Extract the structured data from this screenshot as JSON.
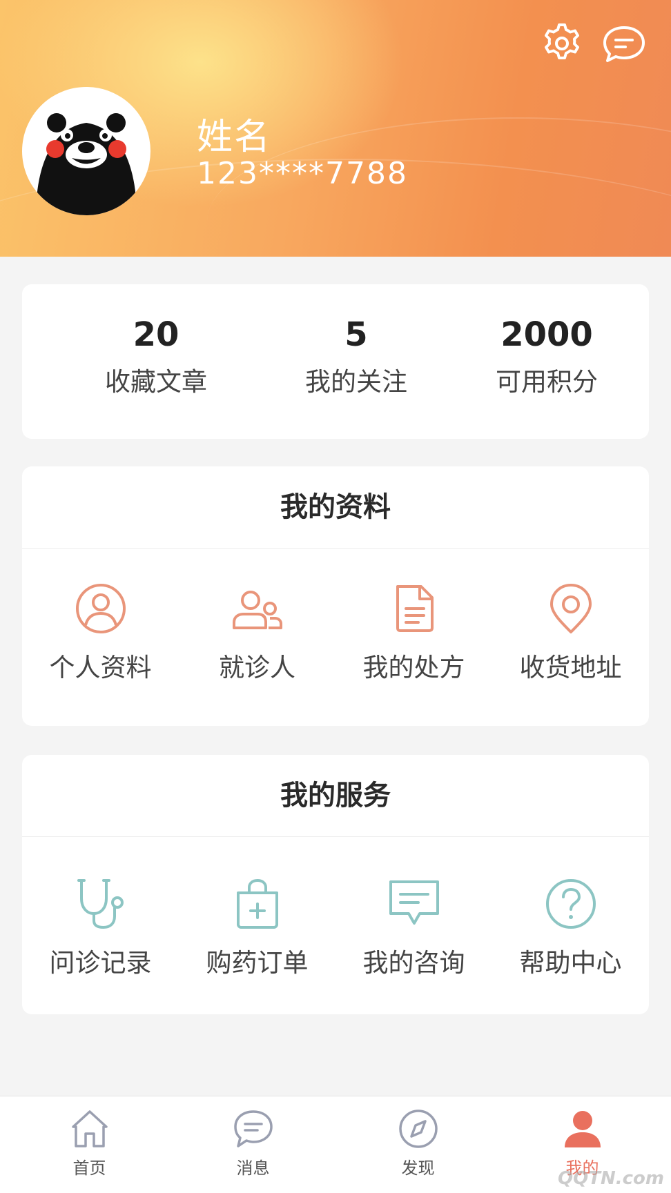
{
  "profile": {
    "name": "姓名",
    "phone": "123****7788"
  },
  "header": {
    "settings_icon": "gear-icon",
    "message_icon": "chat-bubble-icon"
  },
  "stats": [
    {
      "value": "20",
      "label": "收藏文章"
    },
    {
      "value": "5",
      "label": "我的关注"
    },
    {
      "value": "2000",
      "label": "可用积分"
    }
  ],
  "my_info": {
    "title": "我的资料",
    "items": [
      {
        "label": "个人资料",
        "icon": "user-circle-icon"
      },
      {
        "label": "就诊人",
        "icon": "patients-icon"
      },
      {
        "label": "我的处方",
        "icon": "document-icon"
      },
      {
        "label": "收货地址",
        "icon": "location-pin-icon"
      }
    ]
  },
  "my_services": {
    "title": "我的服务",
    "items": [
      {
        "label": "问诊记录",
        "icon": "stethoscope-icon"
      },
      {
        "label": "购药订单",
        "icon": "shopping-bag-icon"
      },
      {
        "label": "我的咨询",
        "icon": "message-icon"
      },
      {
        "label": "帮助中心",
        "icon": "help-circle-icon"
      }
    ]
  },
  "tabbar": {
    "items": [
      {
        "label": "首页",
        "icon": "home-icon"
      },
      {
        "label": "消息",
        "icon": "message-bubble-icon"
      },
      {
        "label": "发现",
        "icon": "compass-icon"
      },
      {
        "label": "我的",
        "icon": "person-icon",
        "active": true
      }
    ]
  },
  "watermark": "QQTN.com",
  "colors": {
    "accent": "#e9705e",
    "info_icon": "#e9957a",
    "service_icon": "#8cc5c3",
    "tab_icon": "#9a9fb0"
  }
}
